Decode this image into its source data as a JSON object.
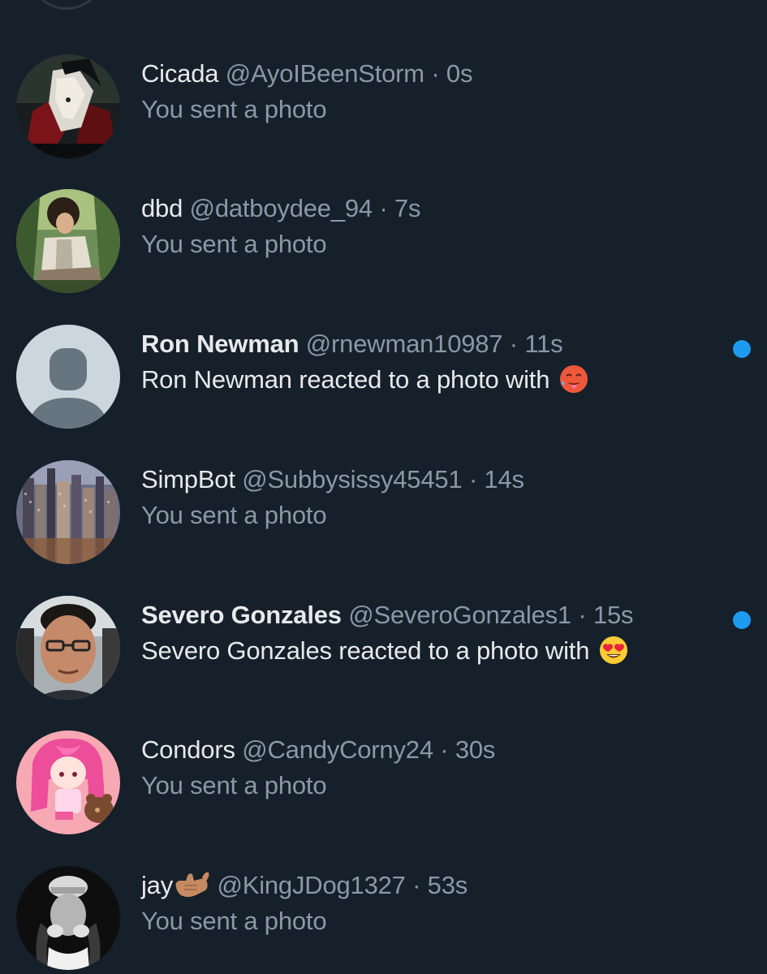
{
  "conversations": [
    {
      "name": "Cicada",
      "handle": "@AyoIBeenStorm",
      "separator": "·",
      "time": "0s",
      "preview": "You sent a photo",
      "unread": false,
      "avatar": "dark-anime-avatar"
    },
    {
      "name": "dbd",
      "handle": "@datboydee_94",
      "separator": "·",
      "time": "7s",
      "preview": "You sent a photo",
      "unread": false,
      "avatar": "anime-samurai-avatar"
    },
    {
      "name": "Ron Newman",
      "handle": "@rnewman10987",
      "separator": "·",
      "time": "11s",
      "preview": "Ron Newman reacted to a photo with",
      "reaction_emoji": "hot-face-emoji",
      "unread": true,
      "avatar": "default-profile-avatar"
    },
    {
      "name": "SimpBot",
      "handle": "@Subbysissy45451",
      "separator": "·",
      "time": "14s",
      "preview": "You sent a photo",
      "unread": false,
      "avatar": "city-skyline-avatar"
    },
    {
      "name": "Severo Gonzales",
      "handle": "@SeveroGonzales1",
      "separator": "·",
      "time": "15s",
      "preview": "Severo Gonzales reacted to a photo with",
      "reaction_emoji": "heart-eyes-emoji",
      "unread": true,
      "avatar": "man-glasses-avatar"
    },
    {
      "name": "Condors",
      "handle": "@CandyCorny24",
      "separator": "·",
      "time": "30s",
      "preview": "You sent a photo",
      "unread": false,
      "avatar": "pink-anime-girl-avatar"
    },
    {
      "name": "jay",
      "name_emoji": "call-me-hand-emoji",
      "handle": "@KingJDog1327",
      "separator": "·",
      "time": "53s",
      "preview": "You sent a photo",
      "unread": false,
      "avatar": "bw-person-avatar"
    }
  ],
  "colors": {
    "background": "#15202b",
    "primary_text": "#e7e9ea",
    "secondary_text": "#8b98a5",
    "unread_dot": "#1d9bf0"
  }
}
